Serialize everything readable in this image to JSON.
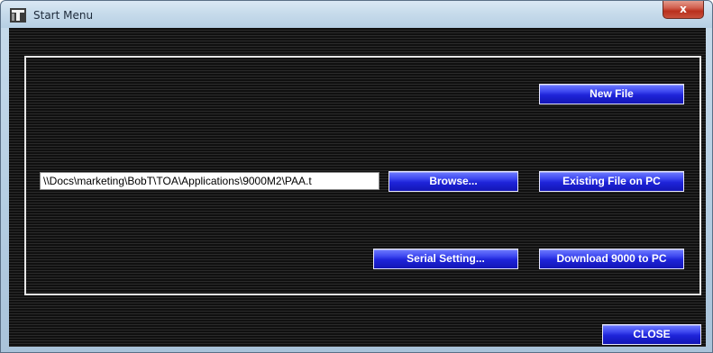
{
  "window": {
    "title": "Start Menu",
    "close_glyph": "x"
  },
  "panel": {
    "path_value": "\\\\Docs\\marketing\\BobT\\TOA\\Applications\\9000M2\\PAA.t",
    "buttons": {
      "new_file": "New File",
      "browse": "Browse...",
      "existing_file": "Existing File on PC",
      "serial_setting": "Serial Setting...",
      "download": "Download 9000 to PC"
    }
  },
  "footer": {
    "close_label": "CLOSE"
  },
  "colors": {
    "button_blue": "#1e24d9",
    "background": "#1a1a1a",
    "panel_border": "#e6e6e6"
  },
  "icons": {
    "app": "toa-app-icon",
    "close": "close-icon"
  }
}
